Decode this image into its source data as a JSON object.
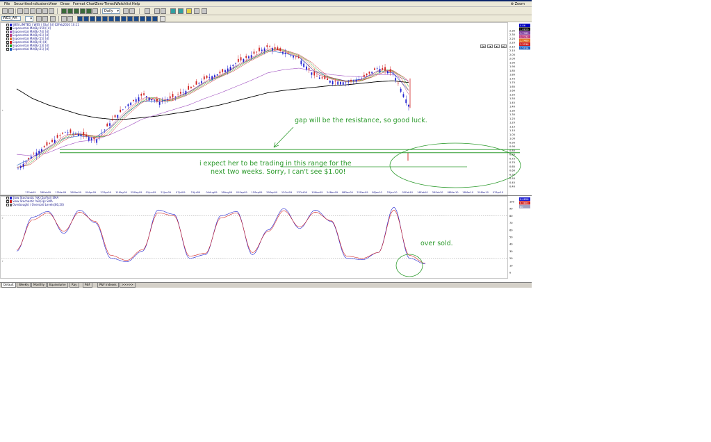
{
  "menu": [
    "File",
    "Securities",
    "Indicators",
    "View",
    "Draw",
    "Format Chart",
    "Zero-Timed",
    "Watchlist",
    "Help"
  ],
  "zoom_label": "Zoom",
  "toolbar": {
    "symbol": "WES_AX",
    "period": "Daily"
  },
  "legend_top": [
    {
      "label": "WES LIMITED ( WES ) [Op] [d]  02Feb2010 10:11",
      "color": "#1f1fd0"
    },
    {
      "label": "Exponential MA(By:150) [d]",
      "color": "#000000"
    },
    {
      "label": "Exponential MA(By:74) [d]",
      "color": "#a050c0"
    },
    {
      "label": "Exponential MA(By:61) [d]",
      "color": "#c04080"
    },
    {
      "label": "Exponential MA(By:55) [d]",
      "color": "#e07020"
    },
    {
      "label": "Exponential MA(By:9) [d]",
      "color": "#d02020"
    },
    {
      "label": "Exponential MA(By:13) [d]",
      "color": "#20a020"
    },
    {
      "label": "Exponential MA(By:21) [d]",
      "color": "#2060c0"
    }
  ],
  "legend_bottom": [
    {
      "label": "Slow Stochastic %K (5p/%d) SMA",
      "color": "#1f1fd0"
    },
    {
      "label": "Slow Stochastic %D(3p) SMA",
      "color": "#d02020"
    },
    {
      "label": "Overbought / Oversold Levels(80,20)",
      "color": "#606060"
    }
  ],
  "value_boxes": [
    {
      "value": "0.86",
      "color": "#0000c0"
    },
    {
      "value": "1.8826",
      "color": "#000000"
    },
    {
      "value": "1.7965",
      "color": "#8040a0"
    },
    {
      "value": "1.7732",
      "color": "#c04080"
    },
    {
      "value": "1.7409",
      "color": "#e07020"
    },
    {
      "value": "1.3236",
      "color": "#d02020"
    },
    {
      "value": "1.5014",
      "color": "#2060c0"
    }
  ],
  "stoch_value_boxes": [
    {
      "value": "0.4826",
      "color": "#1f1fd0"
    },
    {
      "value": "0.3803",
      "color": "#d02020"
    },
    {
      "value": "80",
      "color": "#a0a0c0"
    }
  ],
  "price_axis_ticks": [
    "2.35",
    "2.30",
    "2.25",
    "2.20",
    "2.15",
    "2.10",
    "2.05",
    "2.00",
    "1.95",
    "1.90",
    "1.85",
    "1.80",
    "1.75",
    "1.70",
    "1.65",
    "1.60",
    "1.55",
    "1.50",
    "1.45",
    "1.40",
    "1.35",
    "1.30",
    "1.25",
    "1.20",
    "1.15",
    "1.10",
    "1.05",
    "1.00",
    "0.95",
    "0.90",
    "0.85",
    "0.80",
    "0.75",
    "0.70",
    "0.65",
    "0.60",
    "0.55",
    "0.50",
    "0.45",
    "0.40"
  ],
  "stoch_axis_ticks": [
    "100",
    "90",
    "80",
    "70",
    "60",
    "50",
    "40",
    "30",
    "20",
    "10",
    "0"
  ],
  "date_ticks": [
    "17Feb09",
    "26Feb09",
    "12Mar09",
    "26Mar09",
    "09Apr09",
    "27Apr09",
    "11May09",
    "25May09",
    "01Jun09",
    "22Jun09",
    "07Jul09",
    "21Jul09",
    "04Aug09",
    "18Aug09",
    "01Sep09",
    "15Sep09",
    "29Sep09",
    "13Oct09",
    "27Oct09",
    "10Nov09",
    "24Nov09",
    "08Dec09",
    "22Dec09",
    "08Jan10",
    "22Jan10",
    "05Feb10",
    "16Feb10",
    "26Feb10",
    "08Mar10",
    "18Mar10",
    "29Mar10",
    "07Apr10"
  ],
  "annotations": {
    "gap": "gap will be the resistance, so good luck.",
    "range_line1": "i expect her to be trading in this range for the",
    "range_line2": "next two weeks.  Sorry, I can't see $1.00!",
    "oversold": "over sold."
  },
  "tabs": [
    "Default",
    "Weekly",
    "Monthly",
    "Equivolume",
    "Ray",
    "P&F",
    "P&F Indexes",
    ">>>>>"
  ],
  "chart_data": [
    {
      "type": "candlestick",
      "title": "WES LIMITED ( WES ) [Op] [d]  02Feb2010 10:11",
      "ylim": [
        0.4,
        2.35
      ],
      "x": [
        "17Feb09",
        "26Feb09",
        "12Mar09",
        "26Mar09",
        "09Apr09",
        "27Apr09",
        "11May09",
        "25May09",
        "01Jun09",
        "22Jun09",
        "07Jul09",
        "21Jul09",
        "04Aug09",
        "18Aug09",
        "01Sep09",
        "15Sep09",
        "29Sep09",
        "13Oct09",
        "27Oct09",
        "10Nov09",
        "24Nov09",
        "08Dec09",
        "22Dec09",
        "08Jan10",
        "22Jan10",
        "02Feb10"
      ],
      "close": [
        0.62,
        0.8,
        0.93,
        1.08,
        1.05,
        0.98,
        1.22,
        1.42,
        1.55,
        1.45,
        1.52,
        1.62,
        1.75,
        1.82,
        1.95,
        2.05,
        2.15,
        2.08,
        2.0,
        1.78,
        1.72,
        1.7,
        1.75,
        1.88,
        1.82,
        1.42
      ],
      "series": [
        {
          "name": "Exponential MA(By:150) [d]",
          "values": [
            1.62,
            1.5,
            1.42,
            1.36,
            1.3,
            1.26,
            1.24,
            1.24,
            1.26,
            1.28,
            1.31,
            1.34,
            1.38,
            1.42,
            1.47,
            1.52,
            1.57,
            1.6,
            1.62,
            1.64,
            1.66,
            1.67,
            1.69,
            1.71,
            1.72,
            1.7
          ]
        },
        {
          "name": "Exponential MA(By:74) [d]",
          "values": [
            0.8,
            0.78,
            0.82,
            0.9,
            0.96,
            0.98,
            1.05,
            1.14,
            1.24,
            1.3,
            1.36,
            1.42,
            1.5,
            1.57,
            1.65,
            1.73,
            1.82,
            1.86,
            1.88,
            1.84,
            1.8,
            1.78,
            1.77,
            1.8,
            1.8,
            1.72
          ]
        },
        {
          "name": "Exponential MA(By:21) [d]",
          "values": [
            0.66,
            0.76,
            0.88,
            1.0,
            1.03,
            1.01,
            1.14,
            1.32,
            1.46,
            1.46,
            1.5,
            1.58,
            1.7,
            1.78,
            1.9,
            2.0,
            2.1,
            2.07,
            2.02,
            1.84,
            1.76,
            1.72,
            1.74,
            1.84,
            1.82,
            1.6
          ]
        }
      ],
      "lines": [
        {
          "name": "gap resistance",
          "y": 0.86
        },
        {
          "name": "gap support",
          "y": 0.82
        }
      ]
    },
    {
      "type": "line",
      "title": "Slow Stochastic",
      "ylim": [
        0,
        100
      ],
      "series": [
        {
          "name": "Slow Stochastic %K (5p/%d) SMA",
          "values": [
            30,
            78,
            86,
            55,
            88,
            70,
            20,
            15,
            30,
            88,
            82,
            20,
            25,
            80,
            86,
            25,
            60,
            90,
            62,
            88,
            72,
            20,
            18,
            28,
            92,
            20,
            12
          ]
        },
        {
          "name": "Slow Stochastic %D(3p) SMA",
          "values": [
            32,
            74,
            84,
            58,
            85,
            72,
            24,
            17,
            32,
            84,
            80,
            23,
            27,
            77,
            84,
            28,
            58,
            87,
            64,
            85,
            73,
            23,
            20,
            28,
            88,
            24,
            13
          ]
        }
      ],
      "levels": [
        80,
        20
      ]
    }
  ]
}
